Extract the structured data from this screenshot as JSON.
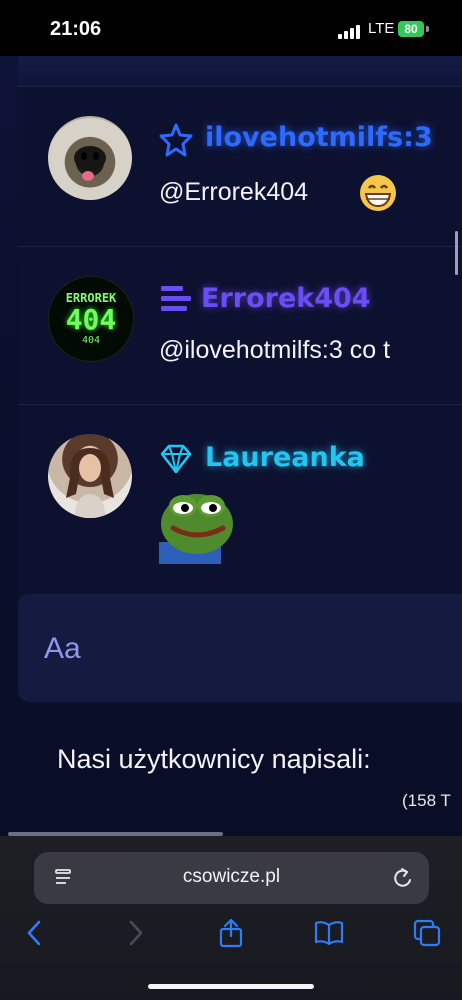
{
  "status_bar": {
    "time": "21:06",
    "network": "LTE",
    "battery": "80"
  },
  "chat": {
    "messages": [
      {
        "username": "ilovehotmilfs:3",
        "username_color": "#2d6bff",
        "rank_icon": "star-icon",
        "text": "@Errorek404",
        "emoji": "grinning-face-emoji"
      },
      {
        "username": "Errorek404",
        "username_color": "#6a4df5",
        "rank_icon": "lines-icon",
        "avatar_text_top": "ERROREK",
        "avatar_text_mid": "404",
        "avatar_text_bottom": "404",
        "text": "@ilovehotmilfs:3 co t"
      },
      {
        "username": "Laureanka",
        "username_color": "#23c6f2",
        "rank_icon": "diamond-icon",
        "sticker": "pepe-frog-sticker"
      }
    ]
  },
  "input": {
    "placeholder": "Aa"
  },
  "footer": {
    "line": "Nasi użytkownicy napisali: ",
    "count": "(158 T"
  },
  "browser": {
    "url": "csowicze.pl",
    "buttons": [
      "back-icon",
      "forward-icon",
      "share-icon",
      "bookmarks-icon",
      "tabs-icon"
    ]
  }
}
